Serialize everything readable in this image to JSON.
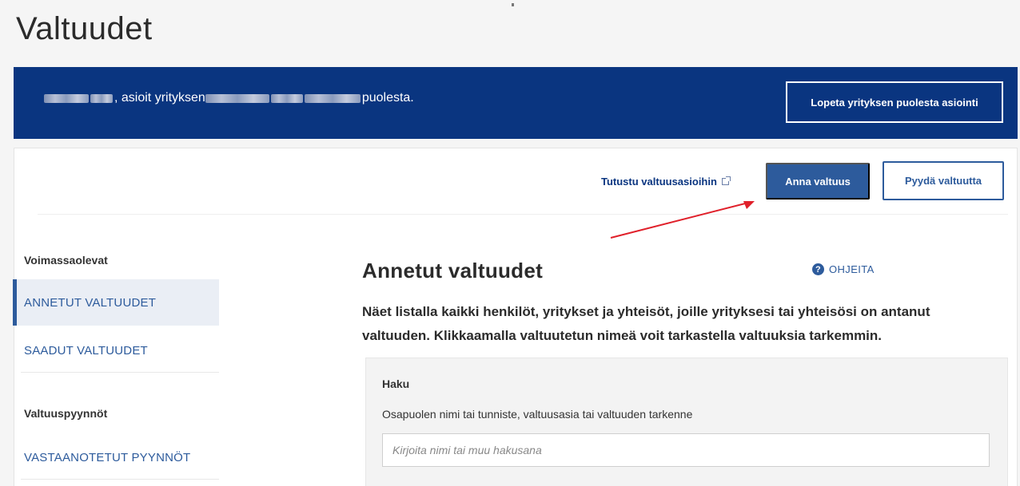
{
  "page": {
    "title": "Valtuudet"
  },
  "banner": {
    "text_middle": ", asioit yrityksen ",
    "text_end": " puolesta.",
    "end_button": "Lopeta yrityksen puolesta asiointi"
  },
  "toolbar": {
    "learn_link": "Tutustu valtuusasioihin",
    "give_button": "Anna valtuus",
    "request_button": "Pyydä valtuutta"
  },
  "sidebar": {
    "section_active": "Voimassaolevat",
    "items_active": [
      {
        "label": "ANNETUT VALTUUDET",
        "selected": true
      },
      {
        "label": "SAADUT VALTUUDET",
        "selected": false
      }
    ],
    "section_requests": "Valtuuspyynnöt",
    "items_requests": [
      {
        "label": "VASTAANOTETUT PYYNNÖT",
        "selected": false
      }
    ]
  },
  "main": {
    "title": "Annetut valtuudet",
    "help_link": "OHJEITA",
    "description": "Näet listalla kaikki henkilöt, yritykset ja yhteisöt, joille yrityksesi tai yhteisösi on antanut valtuuden. Klikkaamalla valtuutetun nimeä voit tarkastella valtuuksia tarkemmin."
  },
  "search": {
    "heading": "Haku",
    "label": "Osapuolen nimi tai tunniste, valtuusasia tai valtuuden tarkenne",
    "placeholder": "Kirjoita nimi tai muu hakusana",
    "value": ""
  },
  "colors": {
    "banner_bg": "#0a3580",
    "primary": "#2d5b9c",
    "annotation_arrow": "#e0202a"
  },
  "icons": {
    "external": "external-link-icon",
    "help": "question-circle-icon"
  }
}
